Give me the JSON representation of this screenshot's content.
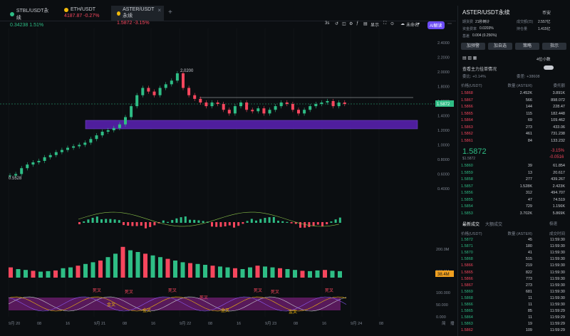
{
  "tabs": [
    {
      "label": "STBL/USDT永续",
      "price": "0.34238",
      "change": "1.51%",
      "dir": "up",
      "color": "#2ebd85"
    },
    {
      "label": "ETH/USDT",
      "price": "4187.87",
      "change": "-0.27%",
      "dir": "down",
      "color": "#f0b90b"
    },
    {
      "label": "ASTER/USDT永续",
      "price": "1.5872",
      "change": "-3.15%",
      "dir": "down",
      "color": "#f0b90b"
    }
  ],
  "toolbar": {
    "interval": "3s",
    "display": "显示",
    "unsaved": "未命名",
    "ai": "AI解读"
  },
  "chart": {
    "y_ticks": [
      "2.4000",
      "2.2000",
      "2.0000",
      "1.8000",
      "1.6000",
      "1.4000",
      "1.2000",
      "1.0000",
      "0.8000",
      "0.6000",
      "0.4000"
    ],
    "x_ticks": [
      "9月 20",
      "08",
      "16",
      "9月 21",
      "08",
      "16",
      "9月 22",
      "08",
      "16",
      "9月 23",
      "08",
      "16",
      "9月 24",
      "08"
    ],
    "x_corner": "简",
    "x_corner2": "播",
    "high_label": "2.0200",
    "low_label": "0.5528",
    "last_price": "1.5872",
    "vol_ticks": [
      "200.0M",
      "100.0M"
    ],
    "vol_last": "38.4M",
    "osc_ticks": [
      "100.000",
      "50.000",
      "0.000"
    ],
    "osc_labels": [
      "死叉",
      "金叉"
    ]
  },
  "chart_data": {
    "type": "candlestick",
    "price_ylim": [
      0.4,
      2.4
    ],
    "candles": [
      0.6,
      0.62,
      0.7,
      0.75,
      0.78,
      0.8,
      0.85,
      0.88,
      0.92,
      0.95,
      0.98,
      1.0,
      1.02,
      1.05,
      1.1,
      1.15,
      1.2,
      1.22,
      1.25,
      1.3,
      1.4,
      1.55,
      1.7,
      1.8,
      1.75,
      1.7,
      1.8,
      1.85,
      1.9,
      2.0,
      1.8,
      1.7,
      1.65,
      1.6,
      1.55,
      1.6,
      1.58,
      1.5,
      1.45,
      1.55,
      1.6,
      1.5,
      1.48,
      1.52,
      1.45,
      1.5,
      1.55,
      1.6,
      1.58,
      1.5,
      1.45,
      1.5,
      1.55,
      1.58,
      1.6,
      1.62,
      1.55,
      1.6,
      1.58
    ],
    "volume": [
      60,
      50,
      45,
      40,
      35,
      38,
      42,
      55,
      60,
      70,
      80,
      90,
      100,
      120,
      140,
      180,
      160,
      150,
      140,
      130,
      120,
      110,
      100,
      90,
      85,
      80,
      75,
      70,
      65,
      60,
      55,
      50,
      60,
      70,
      65,
      60,
      55,
      50,
      45,
      40,
      38,
      42,
      45,
      40,
      38
    ],
    "vol_ylim": [
      0,
      250
    ]
  },
  "panel": {
    "title": "ASTER/USDT永续",
    "tag": "币安",
    "stats": [
      {
        "k": "期货费",
        "v": "21秒倒计"
      },
      {
        "k": "成交额(日)",
        "v": "2.557亿"
      },
      {
        "k": "资金费率",
        "v": "0.0203%"
      },
      {
        "k": "持仓量",
        "v": "1.415亿"
      },
      {
        "k": "基差",
        "v": "0.004 (0.256%)"
      }
    ],
    "buttons": [
      "加预警",
      "加自选",
      "策略",
      "指示"
    ],
    "depth_tabs": [
      "4位小数"
    ],
    "main_info": "查看主力挂单情况",
    "ratio_left": "委比: +0.14%",
    "ratio_right": "委差: +38608",
    "header": [
      "价格(USDT)",
      "数量 (ASTER)",
      "委托额"
    ],
    "asks": [
      [
        "1.5868",
        "2.452K",
        "3.891K"
      ],
      [
        "1.5867",
        "566",
        "898.072"
      ],
      [
        "1.5866",
        "144",
        "228.47"
      ],
      [
        "1.5865",
        "115",
        "182.448"
      ],
      [
        "1.5864",
        "69",
        "109.462"
      ],
      [
        "1.5863",
        "273",
        "433.06"
      ],
      [
        "1.5862",
        "461",
        "731.238"
      ],
      [
        "1.5861",
        "84",
        "133.232"
      ]
    ],
    "mid_price": "1.5872",
    "mid_sub": "$1.5872",
    "mid_change": "-3.15%",
    "mid_change2": "-0.0516",
    "bids": [
      [
        "1.5860",
        "39",
        "61.854"
      ],
      [
        "1.5859",
        "13",
        "20.617"
      ],
      [
        "1.5858",
        "277",
        "439.267"
      ],
      [
        "1.5857",
        "1.528K",
        "2.423K"
      ],
      [
        "1.5856",
        "312",
        "494.707"
      ],
      [
        "1.5855",
        "47",
        "74.519"
      ],
      [
        "1.5854",
        "729",
        "1.156K"
      ],
      [
        "1.5853",
        "3.702K",
        "5.869K"
      ]
    ],
    "trades_tab1": "最新成交",
    "trades_tab2": "大额成交",
    "trades_opt": "极速",
    "trades_header": [
      "价格(USDT)",
      "数量 (ASTER)",
      "成交时间"
    ],
    "trades": [
      [
        "1.5872",
        "45",
        "11:59:30",
        "up"
      ],
      [
        "1.5871",
        "180",
        "11:59:30",
        "up"
      ],
      [
        "1.5870",
        "41",
        "11:59:30",
        "up"
      ],
      [
        "1.5868",
        "515",
        "11:59:30",
        "up"
      ],
      [
        "1.5866",
        "219",
        "11:59:30",
        "down"
      ],
      [
        "1.5865",
        "822",
        "11:59:30",
        "down"
      ],
      [
        "1.5866",
        "773",
        "11:59:30",
        "down"
      ],
      [
        "1.5867",
        "273",
        "11:59:30",
        "down"
      ],
      [
        "1.5869",
        "681",
        "11:59:30",
        "up"
      ],
      [
        "1.5868",
        "11",
        "11:59:30",
        "up"
      ],
      [
        "1.5866",
        "11",
        "11:59:30",
        "up"
      ],
      [
        "1.5865",
        "85",
        "11:59:29",
        "up"
      ],
      [
        "1.5864",
        "11",
        "11:59:29",
        "up"
      ],
      [
        "1.5863",
        "19",
        "11:59:29",
        "up"
      ],
      [
        "1.5862",
        "109",
        "11:59:29",
        "down"
      ]
    ]
  }
}
